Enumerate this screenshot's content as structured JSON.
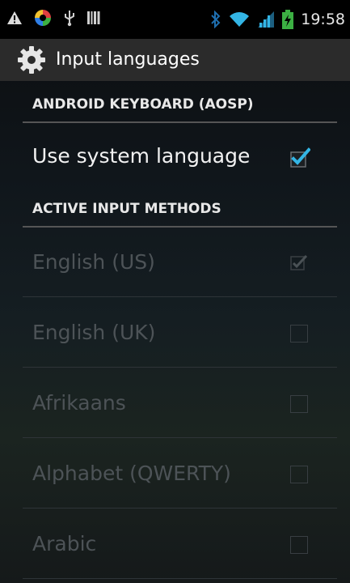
{
  "status_bar": {
    "icons": [
      "warning-icon",
      "app-notification-icon",
      "usb-icon",
      "barcode-icon",
      "bluetooth-icon",
      "wifi-icon",
      "signal-icon",
      "battery-charging-icon"
    ],
    "time": "19:58"
  },
  "action_bar": {
    "icon": "settings-gear-icon",
    "title": "Input languages"
  },
  "sections": [
    {
      "title": "ANDROID KEYBOARD (AOSP)",
      "items": [
        {
          "label": "Use system language",
          "checked": true,
          "enabled": true
        }
      ]
    },
    {
      "title": "ACTIVE INPUT METHODS",
      "items": [
        {
          "label": "English (US)",
          "checked": true,
          "enabled": false
        },
        {
          "label": "English (UK)",
          "checked": false,
          "enabled": false
        },
        {
          "label": "Afrikaans",
          "checked": false,
          "enabled": false
        },
        {
          "label": "Alphabet (QWERTY)",
          "checked": false,
          "enabled": false
        },
        {
          "label": "Arabic",
          "checked": false,
          "enabled": false
        }
      ]
    }
  ],
  "colors": {
    "accent": "#33b5e5",
    "statusbar_bg": "#000000",
    "actionbar_bg": "#2b2b2b"
  }
}
